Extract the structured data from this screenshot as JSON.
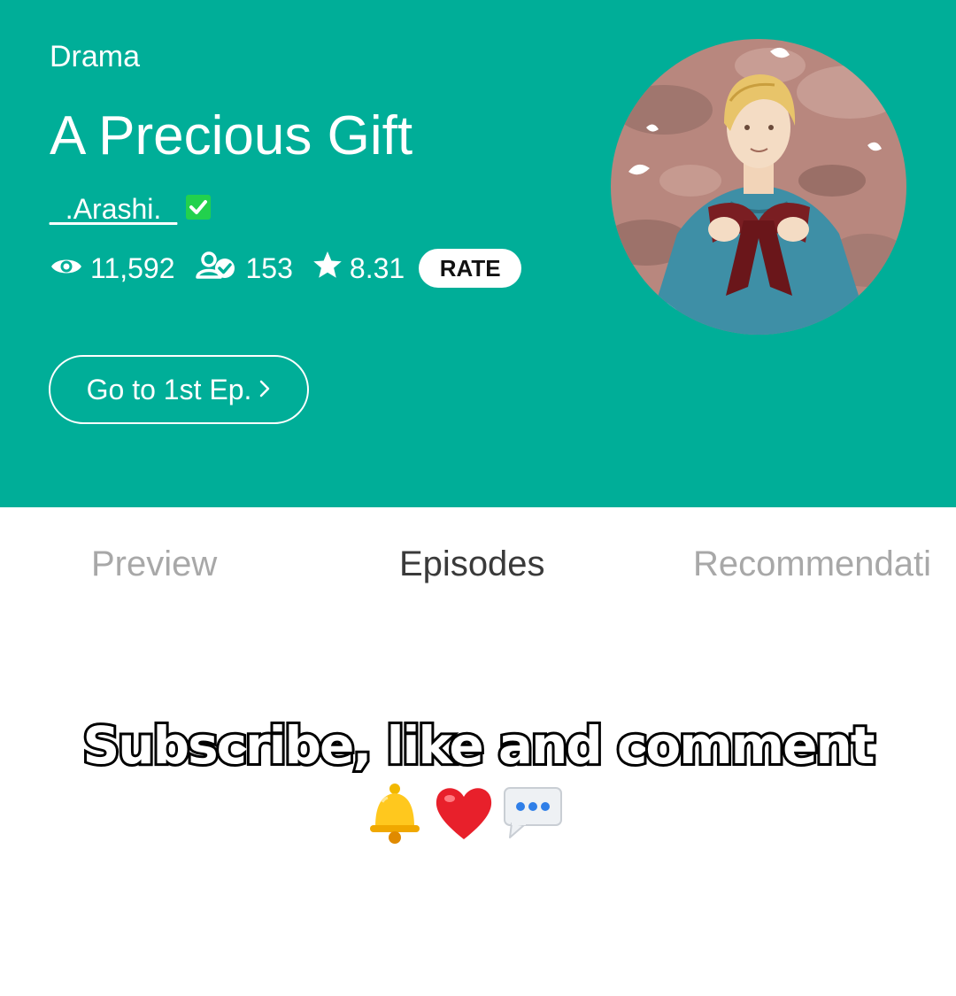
{
  "header": {
    "genre": "Drama",
    "title": "A Precious Gift",
    "author": "_.Arashi._",
    "author_verified": true,
    "stats": {
      "views": "11,592",
      "subscribers": "153",
      "rating": "8.31"
    },
    "rate_label": "RATE",
    "first_episode_label": "Go to 1st Ep.",
    "background_color": "#00AE98"
  },
  "tabs": [
    {
      "label": "Preview",
      "active": false
    },
    {
      "label": "Episodes",
      "active": true
    },
    {
      "label": "Recommendati",
      "active": false
    }
  ],
  "overlay": {
    "text": "Subscribe, like and comment",
    "emojis": [
      "bell-icon",
      "heart-icon",
      "speech-bubble-icon"
    ]
  },
  "icons": {
    "views": "eye-icon",
    "subscribers": "subscriber-icon",
    "rating": "star-icon",
    "verified": "verified-check-icon",
    "chevron": "chevron-right-icon"
  }
}
